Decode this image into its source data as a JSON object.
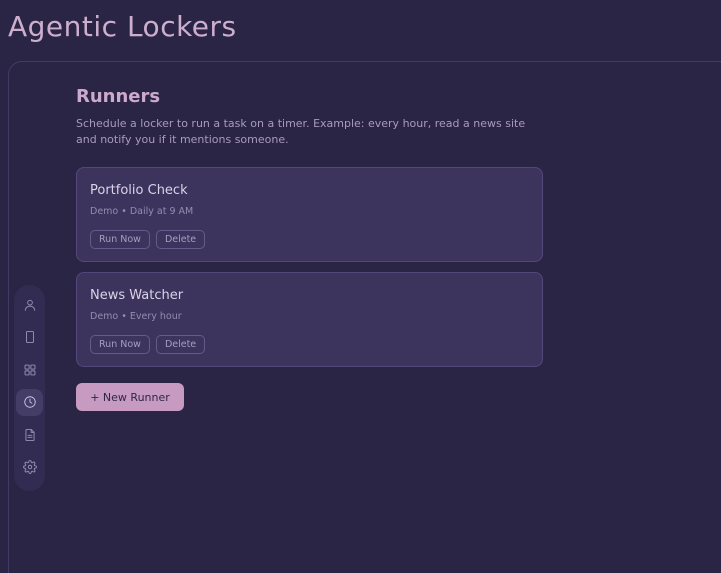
{
  "app": {
    "title": "Agentic Lockers"
  },
  "sidebar": {
    "items": [
      {
        "id": "profile",
        "icon": "user-icon"
      },
      {
        "id": "device",
        "icon": "phone-icon"
      },
      {
        "id": "apps",
        "icon": "grid-icon"
      },
      {
        "id": "runners",
        "icon": "clock-icon",
        "active": true
      },
      {
        "id": "documents",
        "icon": "document-icon"
      },
      {
        "id": "settings",
        "icon": "gear-icon"
      }
    ]
  },
  "page": {
    "title": "Runners",
    "description": "Schedule a locker to run a task on a timer. Example: every hour, read a news site and notify you if it mentions someone."
  },
  "runners": [
    {
      "name": "Portfolio Check",
      "meta": "Demo • Daily at 9 AM",
      "run_label": "Run Now",
      "delete_label": "Delete"
    },
    {
      "name": "News Watcher",
      "meta": "Demo • Every hour",
      "run_label": "Run Now",
      "delete_label": "Delete"
    }
  ],
  "actions": {
    "new_runner_label": "+ New Runner"
  },
  "colors": {
    "background": "#2a2545",
    "accent": "#c69ac1",
    "card": "#3d345e"
  }
}
